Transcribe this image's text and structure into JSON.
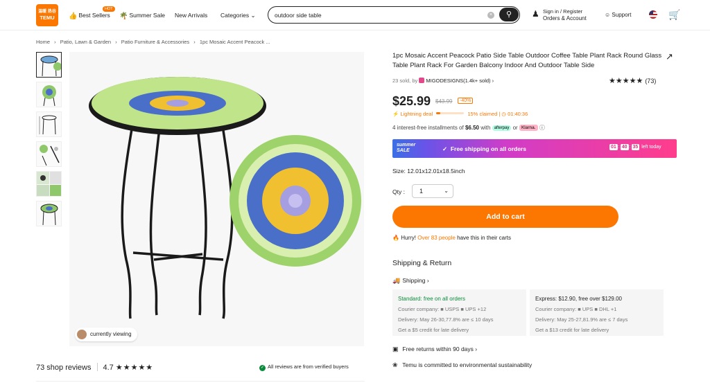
{
  "header": {
    "logo_line1": "温暖 热谷",
    "logo_line2": "TEMU",
    "best_sellers": "Best Sellers",
    "hot_badge": "HOT",
    "summer_sale": "Summer Sale",
    "new_arrivals": "New Arrivals",
    "categories": "Categories",
    "search_value": "outdoor side table",
    "signin": "Sign in / Register",
    "orders": "Orders & Account",
    "support": "Support"
  },
  "breadcrumb": [
    "Home",
    "›",
    "Patio, Lawn & Garden",
    "›",
    "Patio Furniture & Accessories",
    "›",
    "1pc Mosaic Accent Peacock ..."
  ],
  "gallery": {
    "viewing": "currently viewing"
  },
  "reviews": {
    "count_label": "73 shop reviews",
    "rating": "4.7",
    "stars": "★★★★★",
    "verified": "All reviews are from verified buyers"
  },
  "product": {
    "title": "1pc Mosaic Accent Peacock Patio Side Table Outdoor Coffee Table Plant Rack Round Glass Table Plant Rack For Garden Balcony Indoor And Outdoor Table Side",
    "sold_prefix": "23 sold, by",
    "shop": "MIGODESIGNS(1.4k+ sold)",
    "rating_stars": "★★★★★",
    "rating_count": "(73)",
    "price": "$25.99",
    "old_price": "$43.99",
    "discount": "-40%",
    "lightning": "Lightning deal",
    "claimed": "15% claimed",
    "claimed_fraction": 0.15,
    "timer": "01:40:36",
    "install_prefix": "4 interest-free installments of",
    "install_amount": "$6.50",
    "install_with": "with",
    "afterpay": "afterpay",
    "or": "or",
    "klarna": "Klarna.",
    "size": "Size: 12.01x12.01x18.5inch",
    "qty_label": "Qty :",
    "qty_value": "1",
    "add_to_cart": "Add to cart",
    "hurry_prefix": "Hurry!",
    "hurry_count": "Over 83 people",
    "hurry_suffix": "have this in their carts"
  },
  "banner": {
    "summer": "summer",
    "sale": "SALE",
    "free_shipping": "Free shipping on all orders",
    "h": "01",
    "m": "40",
    "s": "35",
    "left": "left today"
  },
  "shipping": {
    "title": "Shipping & Return",
    "shipping_link": "Shipping ›",
    "standard_title": "Standard: free on all orders",
    "standard_courier": "Courier company:  ■ USPS  ■ UPS  +12",
    "standard_delivery": "Delivery: May 26-30,77.8% are ≤ 10 days",
    "standard_credit": "Get a $5 credit for late delivery",
    "express_title": "Express: $12.90, free over $129.00",
    "express_courier": "Courier company:  ■ UPS  ■ DHL  +1",
    "express_delivery": "Delivery: May 25-27,81.9% are ≤ 7 days",
    "express_credit": "Get a $13 credit for late delivery",
    "returns": "Free returns within 90 days ›",
    "eco": "Temu is committed to environmental sustainability"
  }
}
